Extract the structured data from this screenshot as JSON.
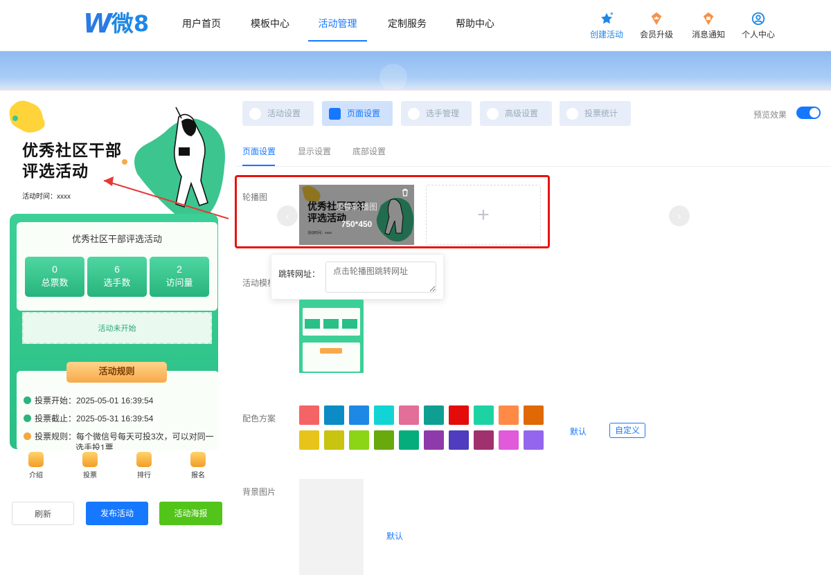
{
  "header": {
    "logo_w": "W",
    "logo_text": "微8",
    "nav": [
      "用户首页",
      "模板中心",
      "活动管理",
      "定制服务",
      "帮助中心"
    ],
    "active_nav": "活动管理",
    "actions": [
      {
        "label": "创建活动",
        "icon": "star-icon",
        "color": "#1e88e5"
      },
      {
        "label": "会员升级",
        "icon": "crown-icon",
        "color": "#f08a3c"
      },
      {
        "label": "消息通知",
        "icon": "bell-icon",
        "color": "#f08a3c"
      },
      {
        "label": "个人中心",
        "icon": "user-icon",
        "color": "#1e88e5"
      }
    ]
  },
  "preview": {
    "title_line1": "优秀社区干部",
    "title_line2": "评选活动",
    "time": "活动时间：xxxx",
    "card_title": "优秀社区干部评选活动",
    "stats": [
      {
        "value": "0",
        "label": "总票数"
      },
      {
        "value": "6",
        "label": "选手数"
      },
      {
        "value": "2",
        "label": "访问量"
      }
    ],
    "status": "活动未开始",
    "rules_title": "活动规则",
    "rules": [
      "投票开始：2025-05-01 16:39:54",
      "投票截止：2025-05-31 16:39:54",
      "投票规则：每个微信号每天可投3次，可以对同一",
      "选手投1票"
    ],
    "tabbar": [
      "介绍",
      "投票",
      "排行",
      "报名"
    ],
    "buttons": {
      "refresh": "刷新",
      "publish": "发布活动",
      "poster": "活动海报"
    }
  },
  "settings": {
    "main_tabs": [
      "活动设置",
      "页面设置",
      "选手管理",
      "高级设置",
      "投票统计"
    ],
    "active_main_tab": "页面设置",
    "preview_label": "预览效果",
    "preview_on": true,
    "sub_tabs": [
      "页面设置",
      "显示设置",
      "底部设置"
    ],
    "active_sub_tab": "页面设置",
    "carousel": {
      "label": "轮播图",
      "overlay": "更换轮播图",
      "size": "750*450",
      "thumb_title_1": "优秀社区干部",
      "thumb_title_2": "评选活动",
      "thumb_time": "活动时间：xxxx"
    },
    "jump": {
      "label": "跳转网址：",
      "placeholder": "点击轮播图跳转网址"
    },
    "template_label": "活动模板",
    "color_label": "配色方案",
    "colors": [
      "#f56464",
      "#0b8cc4",
      "#1e88e5",
      "#13d4d4",
      "#e36e98",
      "#0e9f92",
      "#e40b0b",
      "#1dd3a4",
      "#ff8a45",
      "#e16806",
      "#e7c41a",
      "#c9c311",
      "#8bd416",
      "#68a90e",
      "#06ad7c",
      "#8e3aaa",
      "#4e3dbf",
      "#a1306f",
      "#e05ad9",
      "#9466ee"
    ],
    "color_default": "默认",
    "color_custom": "自定义",
    "bg_label": "背景图片",
    "bg_default": "默认"
  }
}
